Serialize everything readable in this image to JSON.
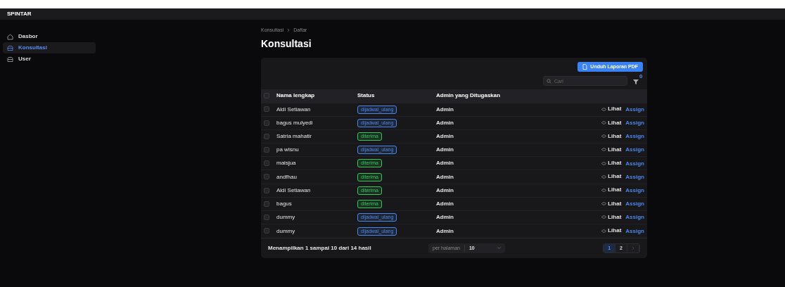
{
  "app": {
    "title": "SPINTAR"
  },
  "sidebar": {
    "items": [
      {
        "label": "Dasbor",
        "selected": false
      },
      {
        "label": "Konsultasi",
        "selected": true
      },
      {
        "label": "User",
        "selected": false
      }
    ]
  },
  "breadcrumb": [
    "Konsultasi",
    "Daftar"
  ],
  "page_title": "Konsultasi",
  "download_button": "Unduh Laporan PDF",
  "search": {
    "placeholder": "Cari"
  },
  "filter_count": "0",
  "table": {
    "select_all_checked": false,
    "columns": [
      "Nama lengkap",
      "Status",
      "Admin yang Ditugaskan"
    ],
    "rows": [
      {
        "name": "Aldi Setiawan",
        "status": "dijadwal_ulang",
        "color": "#4a86e8",
        "admin": "Admin",
        "view": "Lihat",
        "assign": "Assign",
        "checked": false
      },
      {
        "name": "bagus mulyedi",
        "status": "dijadwal_ulang",
        "color": "#4a86e8",
        "admin": "Admin",
        "view": "Lihat",
        "assign": "Assign",
        "checked": false
      },
      {
        "name": "Satria mahatir",
        "status": "diterima",
        "color": "#34c759",
        "admin": "Admin",
        "view": "Lihat",
        "assign": "Assign",
        "checked": false
      },
      {
        "name": "pa wisnu",
        "status": "dijadwal_ulang",
        "color": "#4a86e8",
        "admin": "Admin",
        "view": "Lihat",
        "assign": "Assign",
        "checked": false
      },
      {
        "name": "maisjua",
        "status": "diterima",
        "color": "#34c759",
        "admin": "Admin",
        "view": "Lihat",
        "assign": "Assign",
        "checked": false
      },
      {
        "name": "andfhau",
        "status": "diterima",
        "color": "#34c759",
        "admin": "Admin",
        "view": "Lihat",
        "assign": "Assign",
        "checked": false
      },
      {
        "name": "Aldi Setiawan",
        "status": "diterima",
        "color": "#34c759",
        "admin": "Admin",
        "view": "Lihat",
        "assign": "Assign",
        "checked": false
      },
      {
        "name": "bagus",
        "status": "diterima",
        "color": "#34c759",
        "admin": "Admin",
        "view": "Lihat",
        "assign": "Assign",
        "checked": false
      },
      {
        "name": "dummy",
        "status": "dijadwal_ulang",
        "color": "#4a86e8",
        "admin": "Admin",
        "view": "Lihat",
        "assign": "Assign",
        "checked": false
      },
      {
        "name": "dummy",
        "status": "dijadwal_ulang",
        "color": "#4a86e8",
        "admin": "Admin",
        "view": "Lihat",
        "assign": "Assign",
        "checked": false
      }
    ]
  },
  "footer": {
    "summary": "Menampilkan 1 sampai 10 dari 14 hasil",
    "per_page_label": "per halaman",
    "per_page_value": "10",
    "pages": [
      {
        "label": "1",
        "selected": true
      },
      {
        "label": "2",
        "selected": false
      }
    ]
  }
}
